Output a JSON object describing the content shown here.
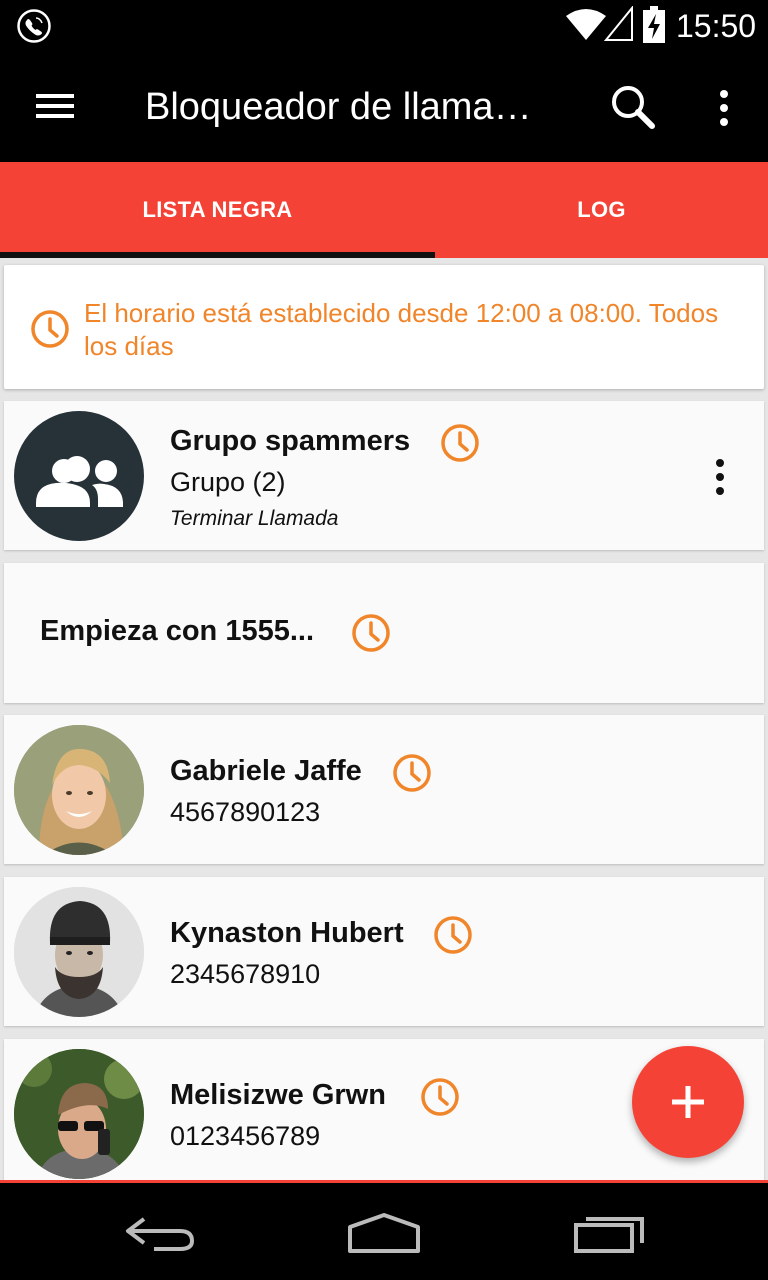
{
  "status_bar": {
    "time": "15:50"
  },
  "app_bar": {
    "title": "Bloqueador de llama…",
    "menu_icon": "hamburger-menu-icon",
    "search_icon": "search-icon",
    "more_icon": "more-vert-icon"
  },
  "tabs": [
    {
      "label": "LISTA NEGRA",
      "selected": true
    },
    {
      "label": "LOG",
      "selected": false
    }
  ],
  "schedule": {
    "text": "El horario está establecido desde 12:00 a 08:00. Todos los días",
    "color": "#f0852a"
  },
  "entries": [
    {
      "name": "Grupo spammers",
      "subtitle": "Grupo (2)",
      "action": "Terminar Llamada",
      "avatar": "group-icon"
    },
    {
      "name": "Empieza con 1555..."
    },
    {
      "name": "Gabriele Jaffe",
      "subtitle": "4567890123",
      "avatar": "photo"
    },
    {
      "name": "Kynaston Hubert",
      "subtitle": "2345678910",
      "avatar": "photo"
    },
    {
      "name": "Melisizwe Grwn",
      "subtitle": "0123456789",
      "avatar": "photo"
    }
  ],
  "fab": {
    "icon": "plus-icon"
  },
  "colors": {
    "accent": "#f44336",
    "clock_icon": "#f0852a",
    "app_bar": "#000000"
  }
}
